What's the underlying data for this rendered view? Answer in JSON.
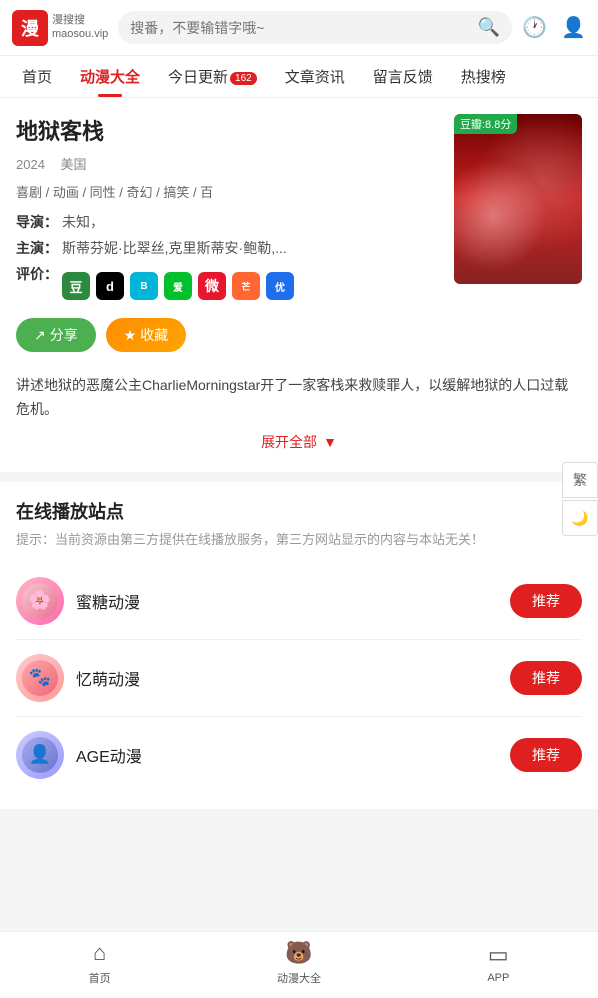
{
  "header": {
    "logo_char": "漫",
    "logo_subtext": "漫搜搜\nmaosou.vip",
    "search_placeholder": "搜番，不要输错字哦~"
  },
  "nav": {
    "items": [
      {
        "label": "首页",
        "active": false,
        "badge": null
      },
      {
        "label": "动漫大全",
        "active": true,
        "badge": null
      },
      {
        "label": "今日更新",
        "active": false,
        "badge": "162"
      },
      {
        "label": "文章资讯",
        "active": false,
        "badge": null
      },
      {
        "label": "留言反馈",
        "active": false,
        "badge": null
      },
      {
        "label": "热搜榜",
        "active": false,
        "badge": null
      }
    ]
  },
  "anime": {
    "title": "地狱客栈",
    "year": "2024",
    "country": "美国",
    "tags": "喜剧 / 动画 / 同性 / 奇幻 / 搞笑 / 百",
    "director_label": "导演：",
    "director": "未知，",
    "cast_label": "主演：",
    "cast": "斯蒂芬妮·比翠丝,克里斯蒂安·鲍勒,...",
    "rating_label": "评价：",
    "cover_badge": "豆瓣:8.8分",
    "description": "讲述地狱的恶魔公主CharlieMorningstar开了一家客栈来救赎罪人，以缓解地狱的人口过载危机。",
    "expand_label": "展开全部",
    "share_label": "分享",
    "collect_label": "收藏"
  },
  "online_section": {
    "title": "在线播放站点",
    "tip": "提示：当前资源由第三方提供在线播放服务，第三方网站显示的内容与本站无关！",
    "sources": [
      {
        "name": "蜜糖动漫",
        "badge": "推荐",
        "avatar_type": "mitang"
      },
      {
        "name": "忆萌动漫",
        "badge": "推荐",
        "avatar_type": "yimeng"
      },
      {
        "name": "AGE动漫",
        "badge": "推荐",
        "avatar_type": "age"
      }
    ]
  },
  "floating": {
    "traditional_label": "繁",
    "night_mode_label": "🌙"
  },
  "bottom_nav": {
    "items": [
      {
        "label": "首页",
        "icon": "home"
      },
      {
        "label": "动漫大全",
        "icon": "bear"
      },
      {
        "label": "APP",
        "icon": "app"
      }
    ]
  }
}
